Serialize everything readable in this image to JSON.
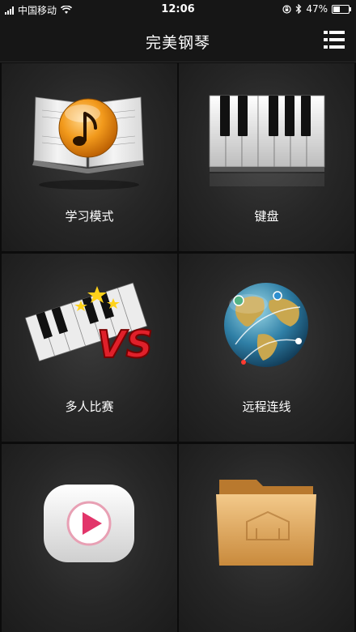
{
  "status_bar": {
    "carrier": "中国移动",
    "time": "12:06",
    "battery": "47%",
    "battery_level": 0.47
  },
  "header": {
    "title": "完美钢琴",
    "menu_icon": "list-menu-icon"
  },
  "tiles": [
    {
      "label": "学习模式",
      "icon": "music-book-icon"
    },
    {
      "label": "键盘",
      "icon": "piano-keyboard-icon"
    },
    {
      "label": "多人比赛",
      "icon": "versus-piano-icon"
    },
    {
      "label": "远程连线",
      "icon": "globe-network-icon"
    },
    {
      "label": "",
      "icon": "video-play-icon"
    },
    {
      "label": "",
      "icon": "folder-icon"
    }
  ]
}
